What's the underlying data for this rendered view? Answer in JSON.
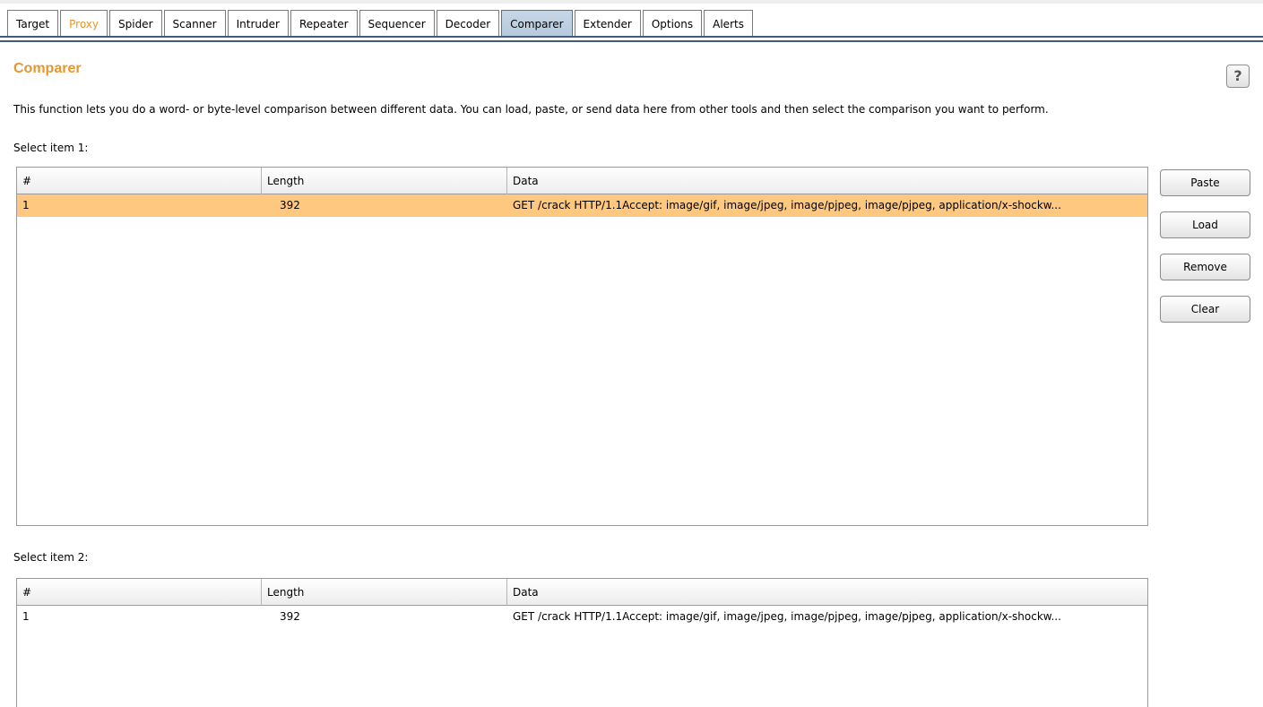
{
  "tabs": [
    {
      "label": "Target"
    },
    {
      "label": "Proxy"
    },
    {
      "label": "Spider"
    },
    {
      "label": "Scanner"
    },
    {
      "label": "Intruder"
    },
    {
      "label": "Repeater"
    },
    {
      "label": "Sequencer"
    },
    {
      "label": "Decoder"
    },
    {
      "label": "Comparer"
    },
    {
      "label": "Extender"
    },
    {
      "label": "Options"
    },
    {
      "label": "Alerts"
    }
  ],
  "active_tab": "Comparer",
  "highlighted_tab": "Proxy",
  "header": {
    "title": "Comparer",
    "help_label": "?",
    "description": "This function lets you do a word- or byte-level comparison between different data. You can load, paste, or send data here from other tools and then select the comparison you want to perform."
  },
  "item1": {
    "label": "Select item 1:",
    "columns": [
      "#",
      "Length",
      "Data"
    ],
    "rows": [
      {
        "num": "1",
        "length": "392",
        "data": "GET /crack HTTP/1.1Accept: image/gif, image/jpeg, image/pjpeg, image/pjpeg, application/x-shockw..."
      }
    ]
  },
  "item2": {
    "label": "Select item 2:",
    "columns": [
      "#",
      "Length",
      "Data"
    ],
    "rows": [
      {
        "num": "1",
        "length": "392",
        "data": "GET /crack HTTP/1.1Accept: image/gif, image/jpeg, image/pjpeg, image/pjpeg, application/x-shockw..."
      }
    ]
  },
  "buttons": {
    "paste": "Paste",
    "load": "Load",
    "remove": "Remove",
    "clear": "Clear"
  },
  "colors": {
    "accent": "#e8962e",
    "selected_row": "#ffc880",
    "active_tab": "#b6c9de",
    "tab_line": "#44587b"
  },
  "icons": {
    "help": "help-icon"
  }
}
